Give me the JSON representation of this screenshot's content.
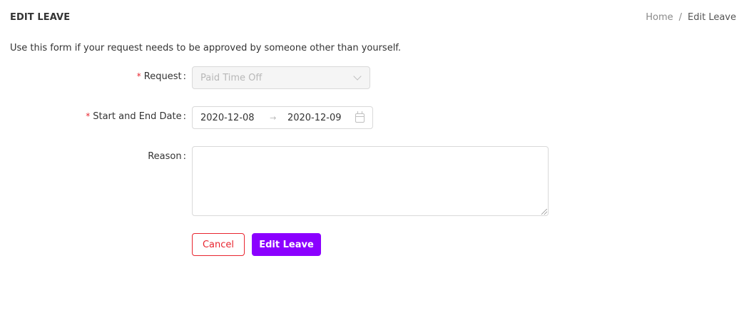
{
  "header": {
    "title": "EDIT LEAVE",
    "breadcrumb": {
      "home": "Home",
      "separator": "/",
      "current": "Edit Leave"
    }
  },
  "intro_text": "Use this form if your request needs to be approved by someone other than yourself.",
  "form": {
    "request": {
      "required_mark": "*",
      "label": "Request",
      "colon": ":",
      "value": "Paid Time Off",
      "disabled": true
    },
    "dates": {
      "required_mark": "*",
      "label": "Start and End Date",
      "colon": ":",
      "start": "2020-12-08",
      "separator": "→",
      "end": "2020-12-09"
    },
    "reason": {
      "label": "Reason",
      "colon": ":",
      "value": ""
    }
  },
  "actions": {
    "cancel_label": "Cancel",
    "submit_label": "Edit Leave"
  },
  "colors": {
    "accent": "#8b00ff",
    "danger": "#e8252f",
    "border": "#d9d9d9"
  },
  "icons": {
    "request_dropdown": "chevron-down-icon",
    "date_picker": "calendar-icon"
  }
}
